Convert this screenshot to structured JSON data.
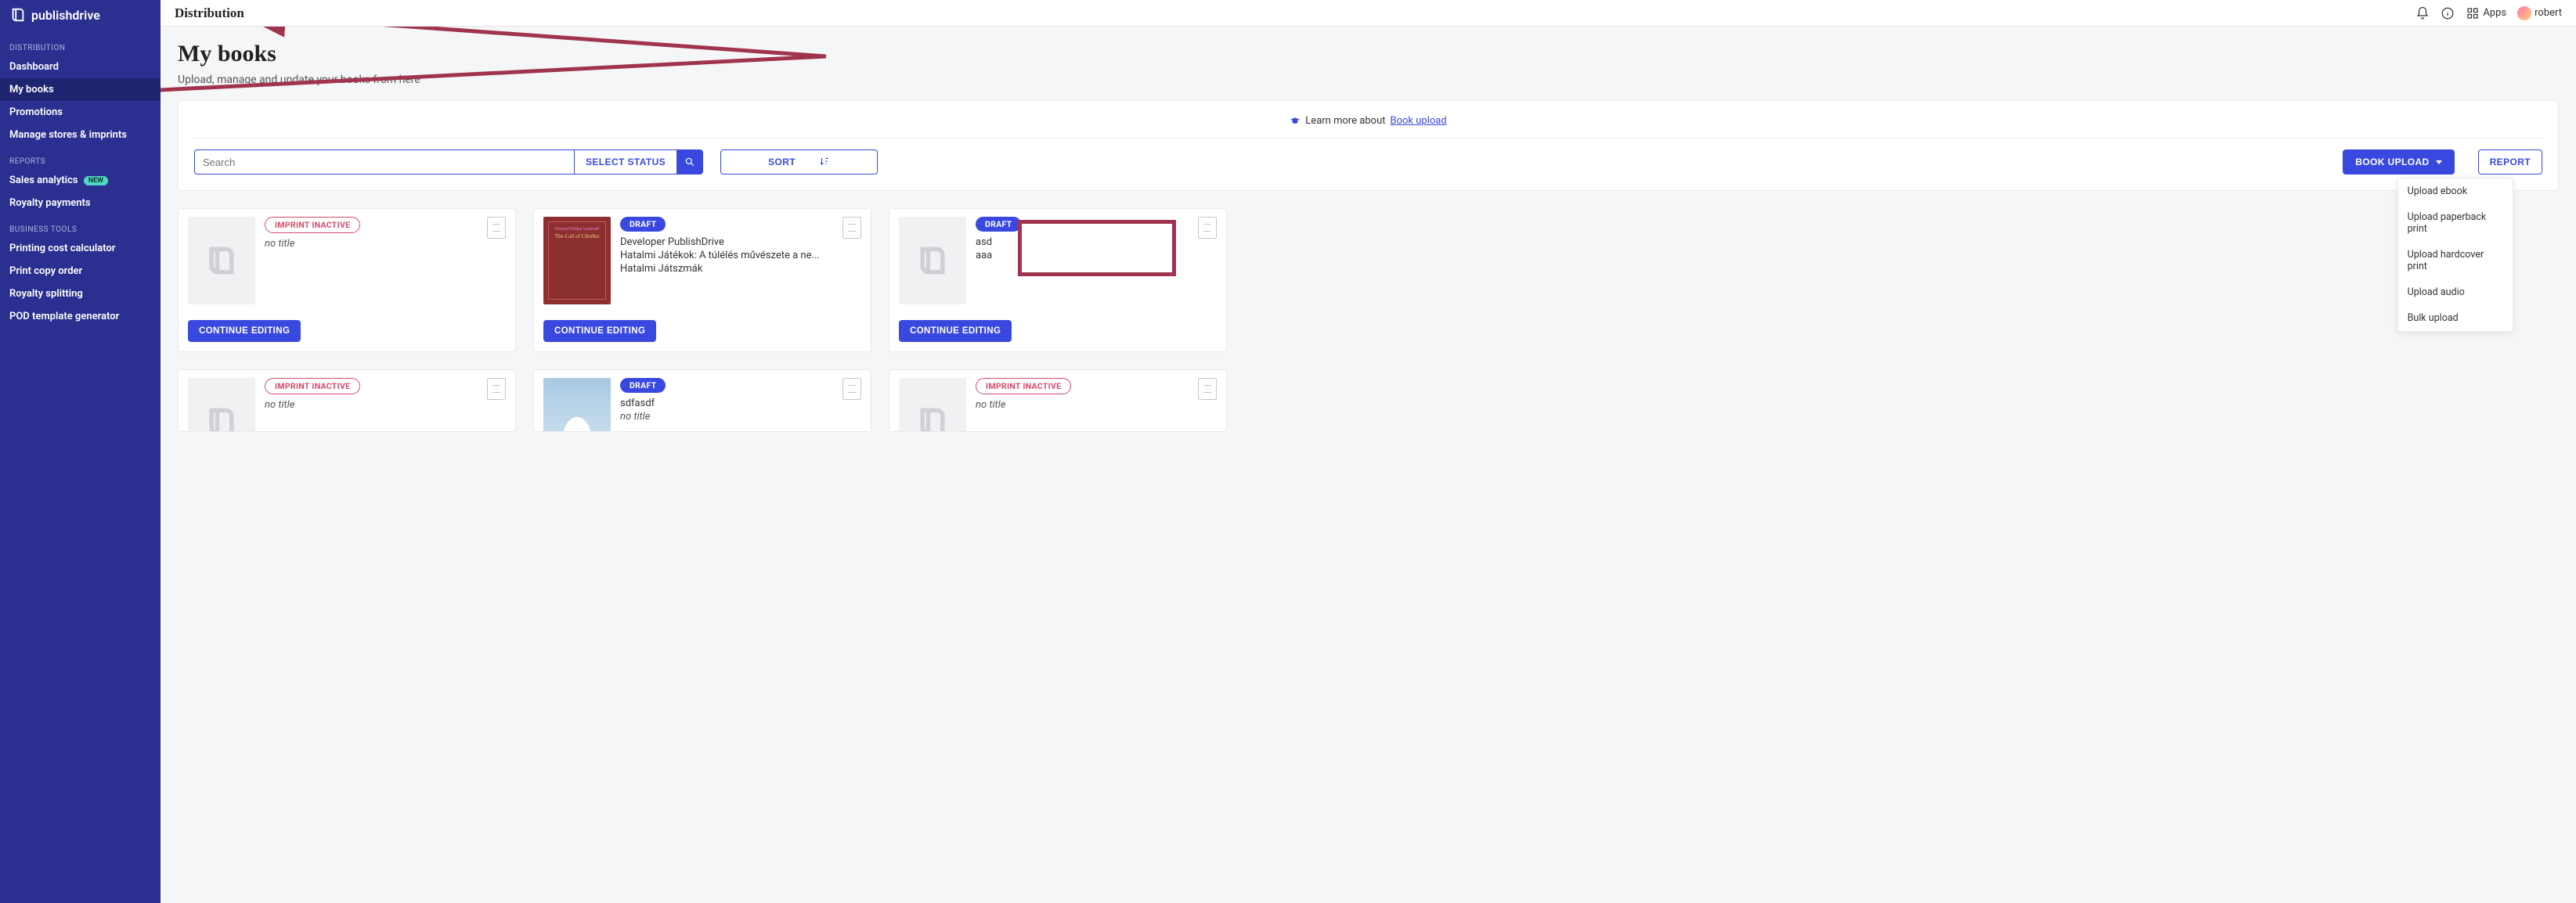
{
  "brand": {
    "name": "publishdrive"
  },
  "sidebar": {
    "sections": [
      {
        "label": "DISTRIBUTION",
        "items": [
          {
            "label": "Dashboard"
          },
          {
            "label": "My books",
            "active": true
          },
          {
            "label": "Promotions"
          },
          {
            "label": "Manage stores & imprints"
          }
        ]
      },
      {
        "label": "REPORTS",
        "items": [
          {
            "label": "Sales analytics",
            "badge": "NEW"
          },
          {
            "label": "Royalty payments"
          }
        ]
      },
      {
        "label": "BUSINESS TOOLS",
        "items": [
          {
            "label": "Printing cost calculator"
          },
          {
            "label": "Print copy order"
          },
          {
            "label": "Royalty splitting"
          },
          {
            "label": "POD template generator"
          }
        ]
      }
    ]
  },
  "topbar": {
    "crumb": "Distribution",
    "apps_label": "Apps",
    "user": "robert"
  },
  "page": {
    "title": "My books",
    "subtitle": "Upload, manage and update your books from here"
  },
  "panel": {
    "learn_prefix": "Learn more about ",
    "learn_link": "Book upload",
    "search_placeholder": "Search",
    "select_status": "SELECT STATUS",
    "sort": "SORT",
    "book_upload": "BOOK UPLOAD",
    "report": "REPORT",
    "upload_menu": [
      "Upload ebook",
      "Upload paperback print",
      "Upload hardcover print",
      "Upload audio",
      "Bulk upload"
    ]
  },
  "statuses": {
    "inactive": "IMPRINT INACTIVE",
    "draft": "DRAFT"
  },
  "continue_label": "CONTINUE EDITING",
  "books_row1": [
    {
      "status": "inactive",
      "cover": "placeholder",
      "lines": [
        "no title"
      ],
      "italic": [
        true
      ]
    },
    {
      "status": "draft",
      "cover": "red",
      "cover_text_small": "Howard Phillips Lovecraft",
      "cover_text_big": "The Call of Cthulhu",
      "lines": [
        "Developer PublishDrive",
        "Hatalmi Játékok: A túlélés művészete a ne...",
        "Hatalmi Játszmák"
      ],
      "italic": [
        false,
        false,
        false
      ]
    },
    {
      "status": "draft",
      "cover": "placeholder",
      "lines": [
        "asd",
        "aaa"
      ],
      "italic": [
        false,
        false
      ]
    }
  ],
  "books_row2": [
    {
      "status": "inactive",
      "cover": "placeholder",
      "lines": [
        "no title"
      ],
      "italic": [
        true
      ]
    },
    {
      "status": "draft",
      "cover": "sky",
      "lines": [
        "sdfasdf",
        "no title"
      ],
      "italic": [
        false,
        true
      ]
    },
    {
      "status": "inactive",
      "cover": "placeholder",
      "lines": [
        "no title"
      ],
      "italic": [
        true
      ]
    }
  ],
  "colors": {
    "sidebar_bg": "#2b3090",
    "primary": "#3949e0",
    "annotation": "#a0344e",
    "badge_new": "#4dd8c2",
    "pill_inactive": "#d84a6a"
  }
}
